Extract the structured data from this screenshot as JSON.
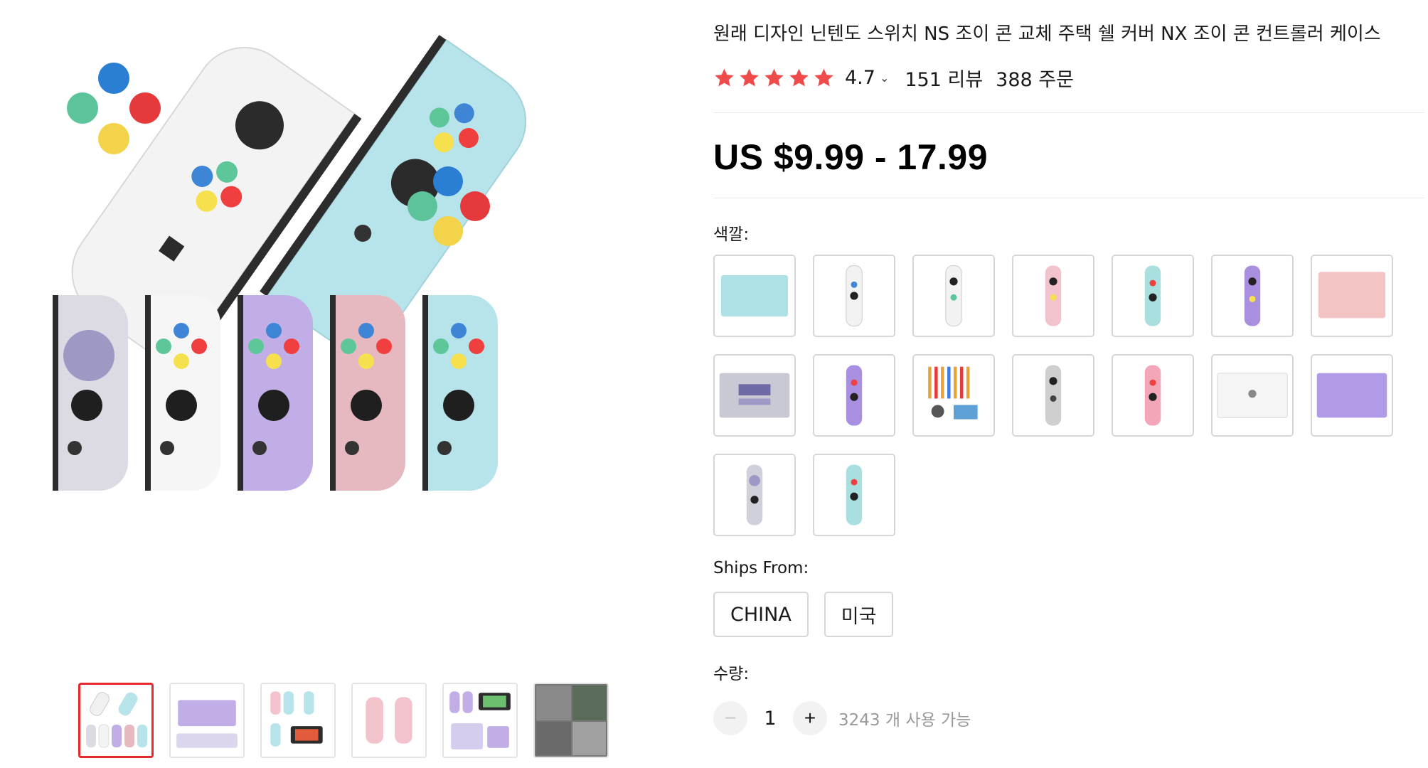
{
  "product": {
    "title": "원래 디자인 닌텐도 스위치 NS 조이 콘 교체 주택 쉘 커버 NX 조이 콘 컨트롤러 케이스",
    "rating": "4.7",
    "reviews": "151 리뷰",
    "orders": "388 주문",
    "price": "US $9.99 - 17.99"
  },
  "colors": {
    "label": "색깔:",
    "accent_red": "#e8282b",
    "star_color": "#f04b4b",
    "swatches": [
      {
        "name": "light-blue-shell-back",
        "color": "#aee1e6"
      },
      {
        "name": "white-joycon",
        "color": "#f2f2f2"
      },
      {
        "name": "white-joycon-2",
        "color": "#f2f2f2"
      },
      {
        "name": "pink-joycon",
        "color": "#f2c3cc"
      },
      {
        "name": "teal-joycon",
        "color": "#a9e0df"
      },
      {
        "name": "purple-joycon",
        "color": "#a88fe0"
      },
      {
        "name": "pink-shell-back",
        "color": "#f4c3c3"
      },
      {
        "name": "snes-shell",
        "color": "#c9c9d4"
      },
      {
        "name": "purple-joycon-2",
        "color": "#a88fe0"
      },
      {
        "name": "tool-kit",
        "color": "#e8a23a"
      },
      {
        "name": "grey-joycon",
        "color": "#cfcfcf"
      },
      {
        "name": "pink-joycon-2",
        "color": "#f2a6b8"
      },
      {
        "name": "white-shell-back",
        "color": "#f5f5f5"
      },
      {
        "name": "purple-shell-back",
        "color": "#b19ae8"
      },
      {
        "name": "snes-joycon",
        "color": "#d0d0da"
      },
      {
        "name": "teal-joycon-2",
        "color": "#a9e0df"
      }
    ]
  },
  "shipping": {
    "label": "Ships From:",
    "options": [
      "CHINA",
      "미국"
    ]
  },
  "quantity": {
    "label": "수량:",
    "value": "1",
    "minus": "−",
    "plus": "+",
    "available": "3243 개 사용 가능"
  },
  "gallery": {
    "thumbnails": [
      "main-set",
      "purple-shell",
      "mixed-set",
      "pink-pair",
      "purple-set",
      "photo-collage"
    ]
  }
}
